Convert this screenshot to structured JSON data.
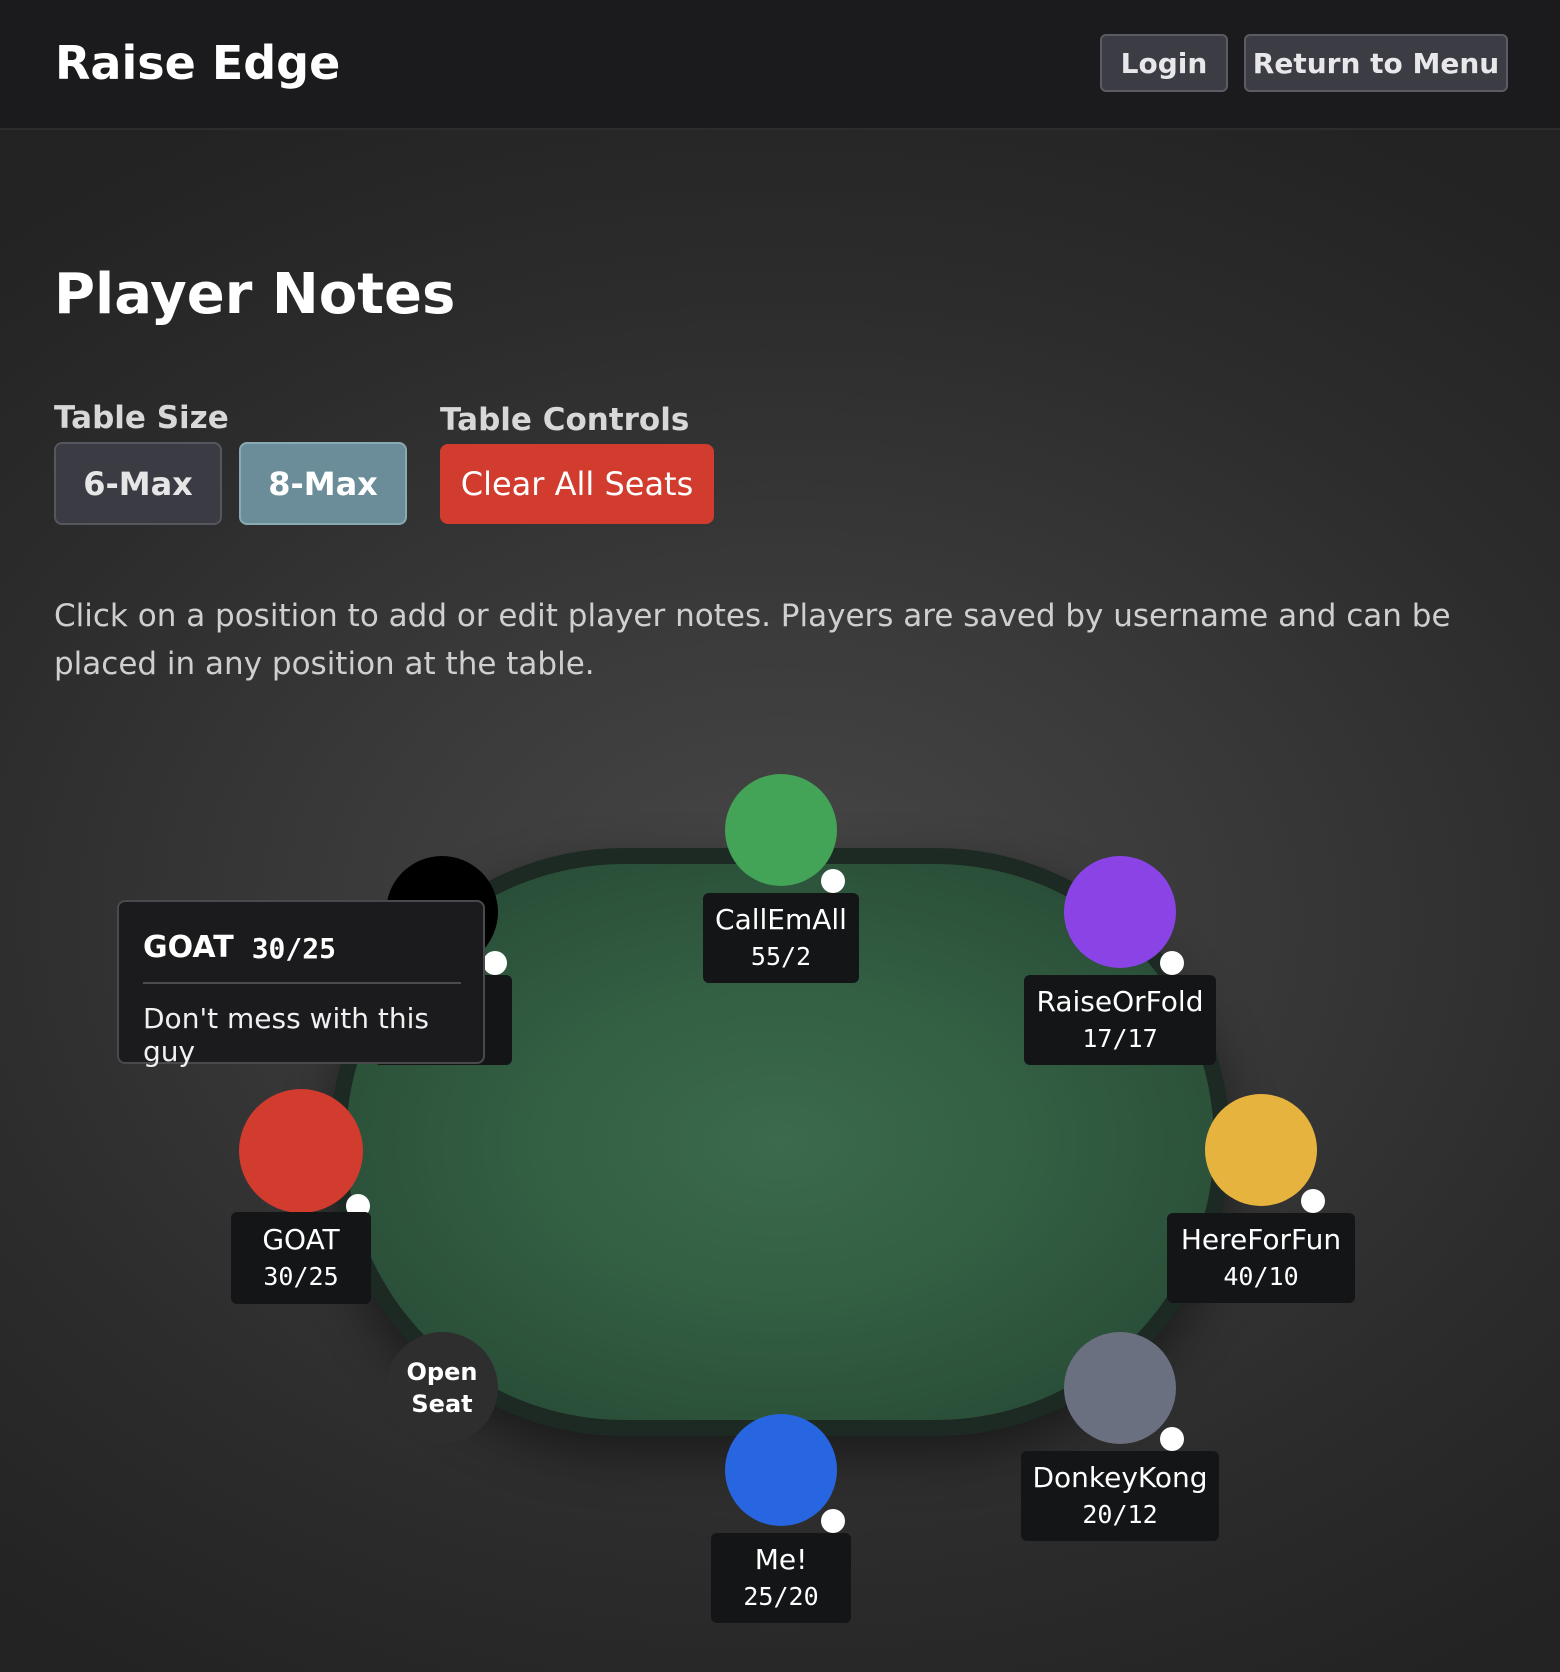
{
  "header": {
    "brand": "Raise Edge",
    "login_label": "Login",
    "menu_label": "Return to Menu"
  },
  "main": {
    "title": "Player Notes",
    "table_size_label": "Table Size",
    "table_controls_label": "Table Controls",
    "size_options": [
      "6-Max",
      "8-Max"
    ],
    "selected_size": "8-Max",
    "clear_label": "Clear All Seats",
    "instructions": "Click on a position to add or edit player notes. Players are saved by username and can be placed in any position at the table."
  },
  "seats": [
    {
      "name": "CallEmAll",
      "stats": "55/2",
      "color": "#43a356"
    },
    {
      "name": "RaiseOrFold",
      "stats": "17/17",
      "color": "#8a44e6"
    },
    {
      "name": "HereForFun",
      "stats": "40/10",
      "color": "#e6b43e"
    },
    {
      "name": "DonkeyKong",
      "stats": "20/12",
      "color": "#6b7080"
    },
    {
      "name": "Me!",
      "stats": "25/20",
      "color": "#2766e0"
    },
    {
      "name": "Open Seat",
      "stats": "",
      "color": "#2e2e2f"
    },
    {
      "name": "GOAT",
      "stats": "30/25",
      "color": "#d23c2e"
    },
    {
      "name": "",
      "stats": "",
      "color": "#000000"
    }
  ],
  "tooltip": {
    "name": "GOAT",
    "stats": "30/25",
    "note": "Don't mess with this guy"
  },
  "colors": {
    "accent": "#6a8d99",
    "danger": "#d23c2e",
    "felt": "#335f43"
  }
}
